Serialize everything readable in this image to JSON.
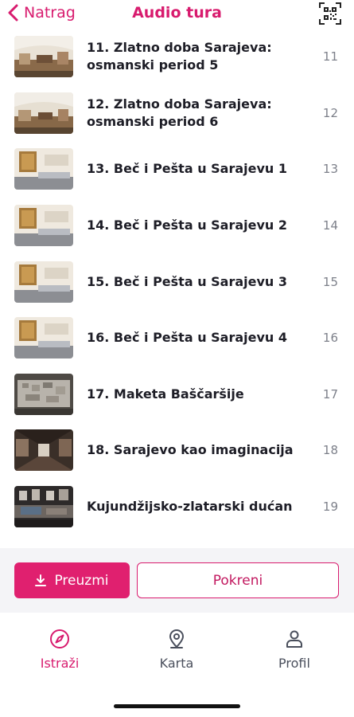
{
  "header": {
    "back_label": "Natrag",
    "title": "Audio tura",
    "qr_icon": "qr-code-icon",
    "accent": "#d81b6e"
  },
  "items": [
    {
      "title": "11. Zlatno doba Sarajeva: osmanski period 5",
      "number": "11",
      "thumb": "gallery"
    },
    {
      "title": "12. Zlatno doba Sarajeva: osmanski period 6",
      "number": "12",
      "thumb": "gallery"
    },
    {
      "title": "13. Beč i Pešta u Sarajevu 1",
      "number": "13",
      "thumb": "carpet"
    },
    {
      "title": "14. Beč i Pešta u Sarajevu 2",
      "number": "14",
      "thumb": "carpet"
    },
    {
      "title": "15. Beč i Pešta u Sarajevu 3",
      "number": "15",
      "thumb": "carpet"
    },
    {
      "title": "16. Beč i Pešta u Sarajevu 4",
      "number": "16",
      "thumb": "carpet"
    },
    {
      "title": "17. Maketa Baščaršije",
      "number": "17",
      "thumb": "model"
    },
    {
      "title": "18. Sarajevo kao imaginacija",
      "number": "18",
      "thumb": "hall"
    },
    {
      "title": "Kujundžijsko-zlatarski dućan",
      "number": "19",
      "thumb": "shop"
    }
  ],
  "actions": {
    "download_label": "Preuzmi",
    "download_icon": "download-icon",
    "start_label": "Pokreni"
  },
  "tabs": [
    {
      "label": "Istraži",
      "icon": "compass-icon",
      "active": true
    },
    {
      "label": "Karta",
      "icon": "map-pin-icon",
      "active": false
    },
    {
      "label": "Profil",
      "icon": "user-icon",
      "active": false
    }
  ],
  "colors": {
    "accent": "#d81b6e",
    "accent_button": "#e0206f",
    "text": "#1d1d26",
    "muted": "#7d808a",
    "action_bg": "#f4f4f7"
  }
}
